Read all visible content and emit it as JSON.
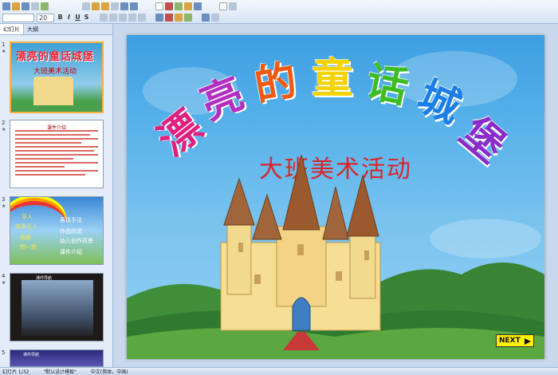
{
  "toolbar": {
    "font_size_value": "20",
    "bold_label": "B",
    "italic_label": "I",
    "underline_label": "U",
    "strike_label": "S"
  },
  "panel": {
    "tabs": [
      "幻灯片",
      "大纲"
    ],
    "slides": [
      {
        "num": "1",
        "title": "漂亮的童话城堡",
        "subtitle": "大班美术活动"
      },
      {
        "num": "2",
        "title": "课件介绍"
      },
      {
        "num": "3",
        "items": [
          "导入",
          "故事引入",
          "观察",
          "想一想",
          "表现手法",
          "作品欣赏",
          "幼儿创作背景",
          "课件介绍"
        ]
      },
      {
        "num": "4",
        "caption": "课件导航"
      },
      {
        "num": "5",
        "caption": "课件导航"
      }
    ]
  },
  "slide": {
    "title_chars": [
      "漂",
      "亮",
      "的",
      "童",
      "话",
      "城",
      "堡"
    ],
    "title_colors": [
      "#e0207f",
      "#b22fc2",
      "#ef5a12",
      "#f5d200",
      "#3ebd22",
      "#1b7ee6",
      "#8a2cc8"
    ],
    "subtitle": "大班美术活动",
    "next_label": "NEXT"
  },
  "status": {
    "slide_counter": "幻灯片 1/32",
    "theme": "\"默认设计模板\"",
    "language": "中文(简体，中国)"
  }
}
